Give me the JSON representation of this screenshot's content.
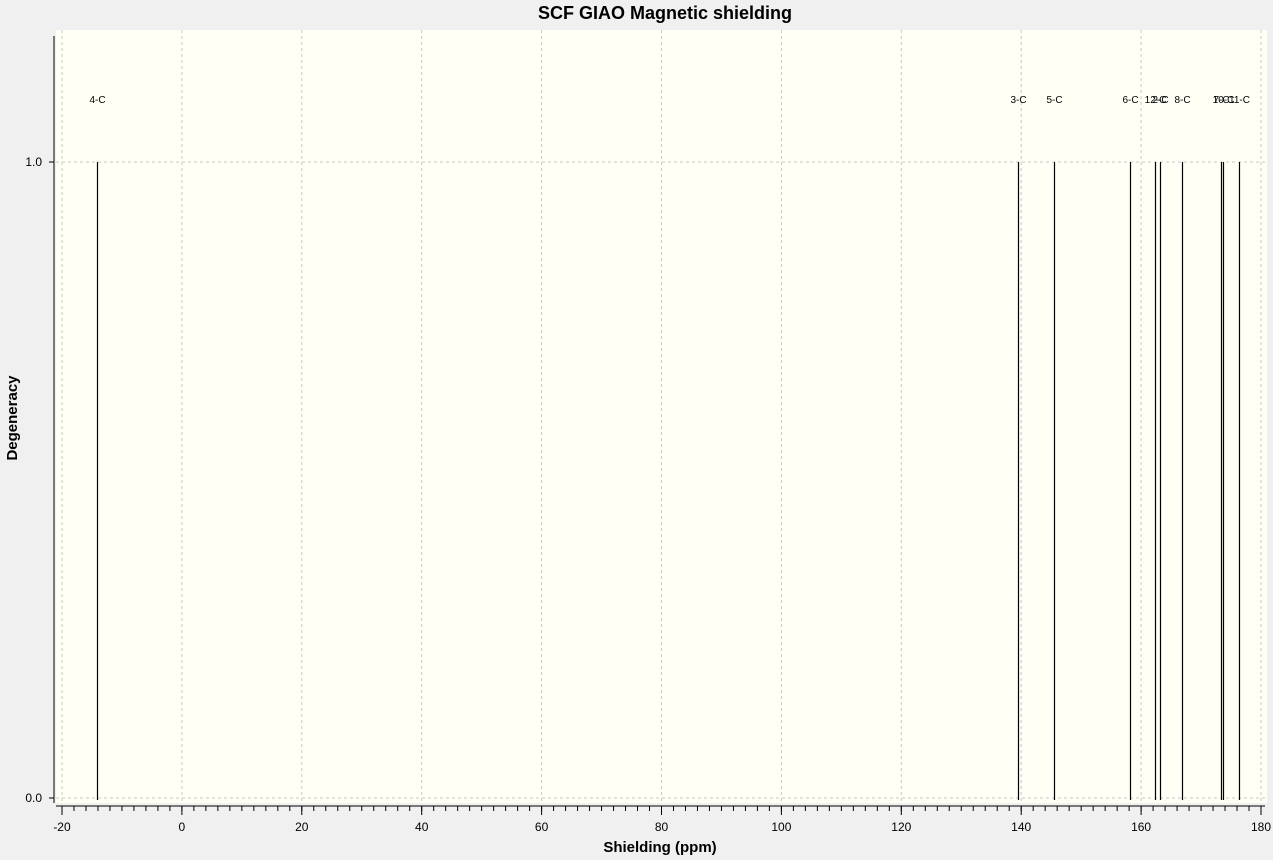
{
  "chart_data": {
    "type": "bar",
    "title": "SCF GIAO Magnetic shielding",
    "xlabel": "Shielding (ppm)",
    "ylabel": "Degeneracy",
    "xlim": [
      -21,
      181
    ],
    "ylim": [
      0,
      1.2
    ],
    "xticks_major": [
      -20,
      0,
      20,
      40,
      60,
      80,
      100,
      120,
      140,
      160,
      180
    ],
    "yticks": [
      0.0,
      1.0
    ],
    "ytick_labels": [
      "0.0",
      "1.0"
    ],
    "grid": true,
    "legend": "none",
    "peaks": [
      {
        "label": "4-C",
        "x": -14.2,
        "y": 1.0
      },
      {
        "label": "3-C",
        "x": 139.5,
        "y": 1.0
      },
      {
        "label": "5-C",
        "x": 145.4,
        "y": 1.0
      },
      {
        "label": "6-C",
        "x": 158.2,
        "y": 1.0
      },
      {
        "label": "12-C",
        "x": 162.4,
        "y": 1.0
      },
      {
        "label": "2-C",
        "x": 163.2,
        "y": 1.0
      },
      {
        "label": "8-C",
        "x": 166.9,
        "y": 1.0
      },
      {
        "label": "7-C",
        "x": 173.3,
        "y": 1.0
      },
      {
        "label": "10-C",
        "x": 173.7,
        "y": 1.0
      },
      {
        "label": "11-C",
        "x": 176.3,
        "y": 1.0
      }
    ],
    "colors": {
      "plot_background": "#fffff6",
      "outer_background": "#f0f0f0",
      "grid": "#c8c8c8",
      "peak": "#000000"
    }
  }
}
